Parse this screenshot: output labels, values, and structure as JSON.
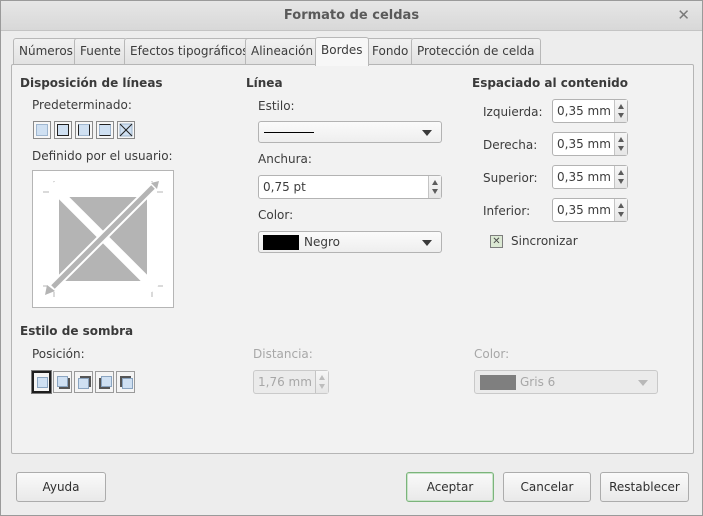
{
  "window": {
    "title": "Formato de celdas",
    "close_glyph": "✕"
  },
  "tabs": [
    {
      "label": "Números"
    },
    {
      "label": "Fuente"
    },
    {
      "label": "Efectos tipográficos"
    },
    {
      "label": "Alineación"
    },
    {
      "label": "Bordes",
      "active": true
    },
    {
      "label": "Fondo"
    },
    {
      "label": "Protección de celda"
    }
  ],
  "line_arrangement": {
    "heading": "Disposición de líneas",
    "presets_label": "Predeterminado:",
    "user_defined_label": "Definido por el usuario:"
  },
  "line": {
    "heading": "Línea",
    "style_label": "Estilo:",
    "width_label": "Anchura:",
    "width_value": "0,75 pt",
    "color_label": "Color:",
    "color_value": "Negro",
    "color_swatch": "#000000"
  },
  "padding": {
    "heading": "Espaciado al contenido",
    "left_label": "Izquierda:",
    "left_value": "0,35 mm",
    "right_label": "Derecha:",
    "right_value": "0,35 mm",
    "top_label": "Superior:",
    "top_value": "0,35 mm",
    "bottom_label": "Inferior:",
    "bottom_value": "0,35 mm",
    "sync_label": "Sincronizar",
    "sync_checked": true,
    "sync_mark": "✕"
  },
  "shadow": {
    "heading": "Estilo de sombra",
    "position_label": "Posición:",
    "distance_label": "Distancia:",
    "distance_value": "1,76 mm",
    "color_label": "Color:",
    "color_value": "Gris 6",
    "color_swatch": "#7f7f7f"
  },
  "buttons": {
    "help": "Ayuda",
    "ok": "Aceptar",
    "cancel": "Cancelar",
    "reset": "Restablecer"
  },
  "colors": {
    "preview_gray": "#b4b4b4",
    "default_button_border": "#7bb47b"
  }
}
